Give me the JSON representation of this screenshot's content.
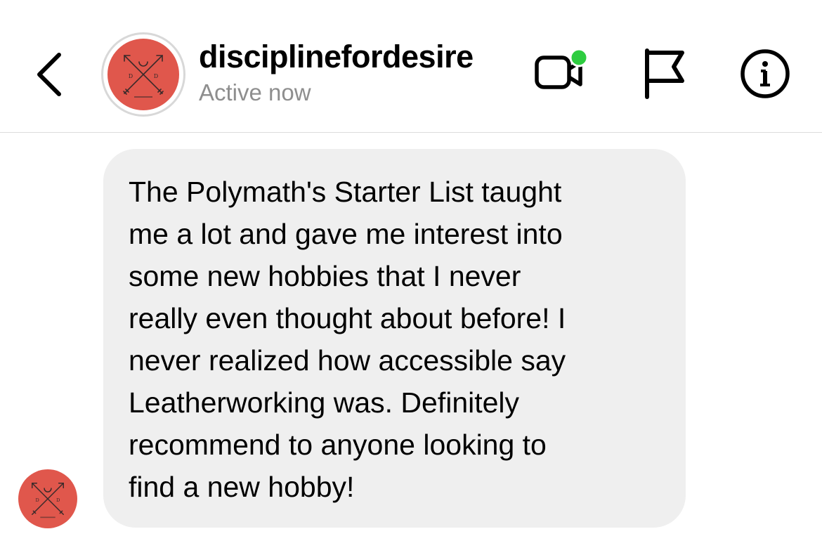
{
  "header": {
    "username": "disciplinefordesire",
    "status": "Active now",
    "avatar_logo": "Discipline for Desire",
    "video_call_active_color": "#2ecc40",
    "icons": [
      "back-chevron-icon",
      "video-camera-icon",
      "flag-icon",
      "info-icon"
    ]
  },
  "conversation": {
    "messages": [
      {
        "text": "The Polymath's Starter List taught\nme a lot and gave me interest into\nsome new hobbies that I never\nreally even thought about before! I\nnever realized how accessible say\nLeatherworking was. Definitely\nrecommend to anyone looking to\nfind a new hobby!"
      }
    ]
  },
  "colors": {
    "avatar_bg": "#e0574c",
    "bubble_bg": "#efefef",
    "status_text": "#8e8e8e",
    "divider": "#dcdcdc"
  }
}
